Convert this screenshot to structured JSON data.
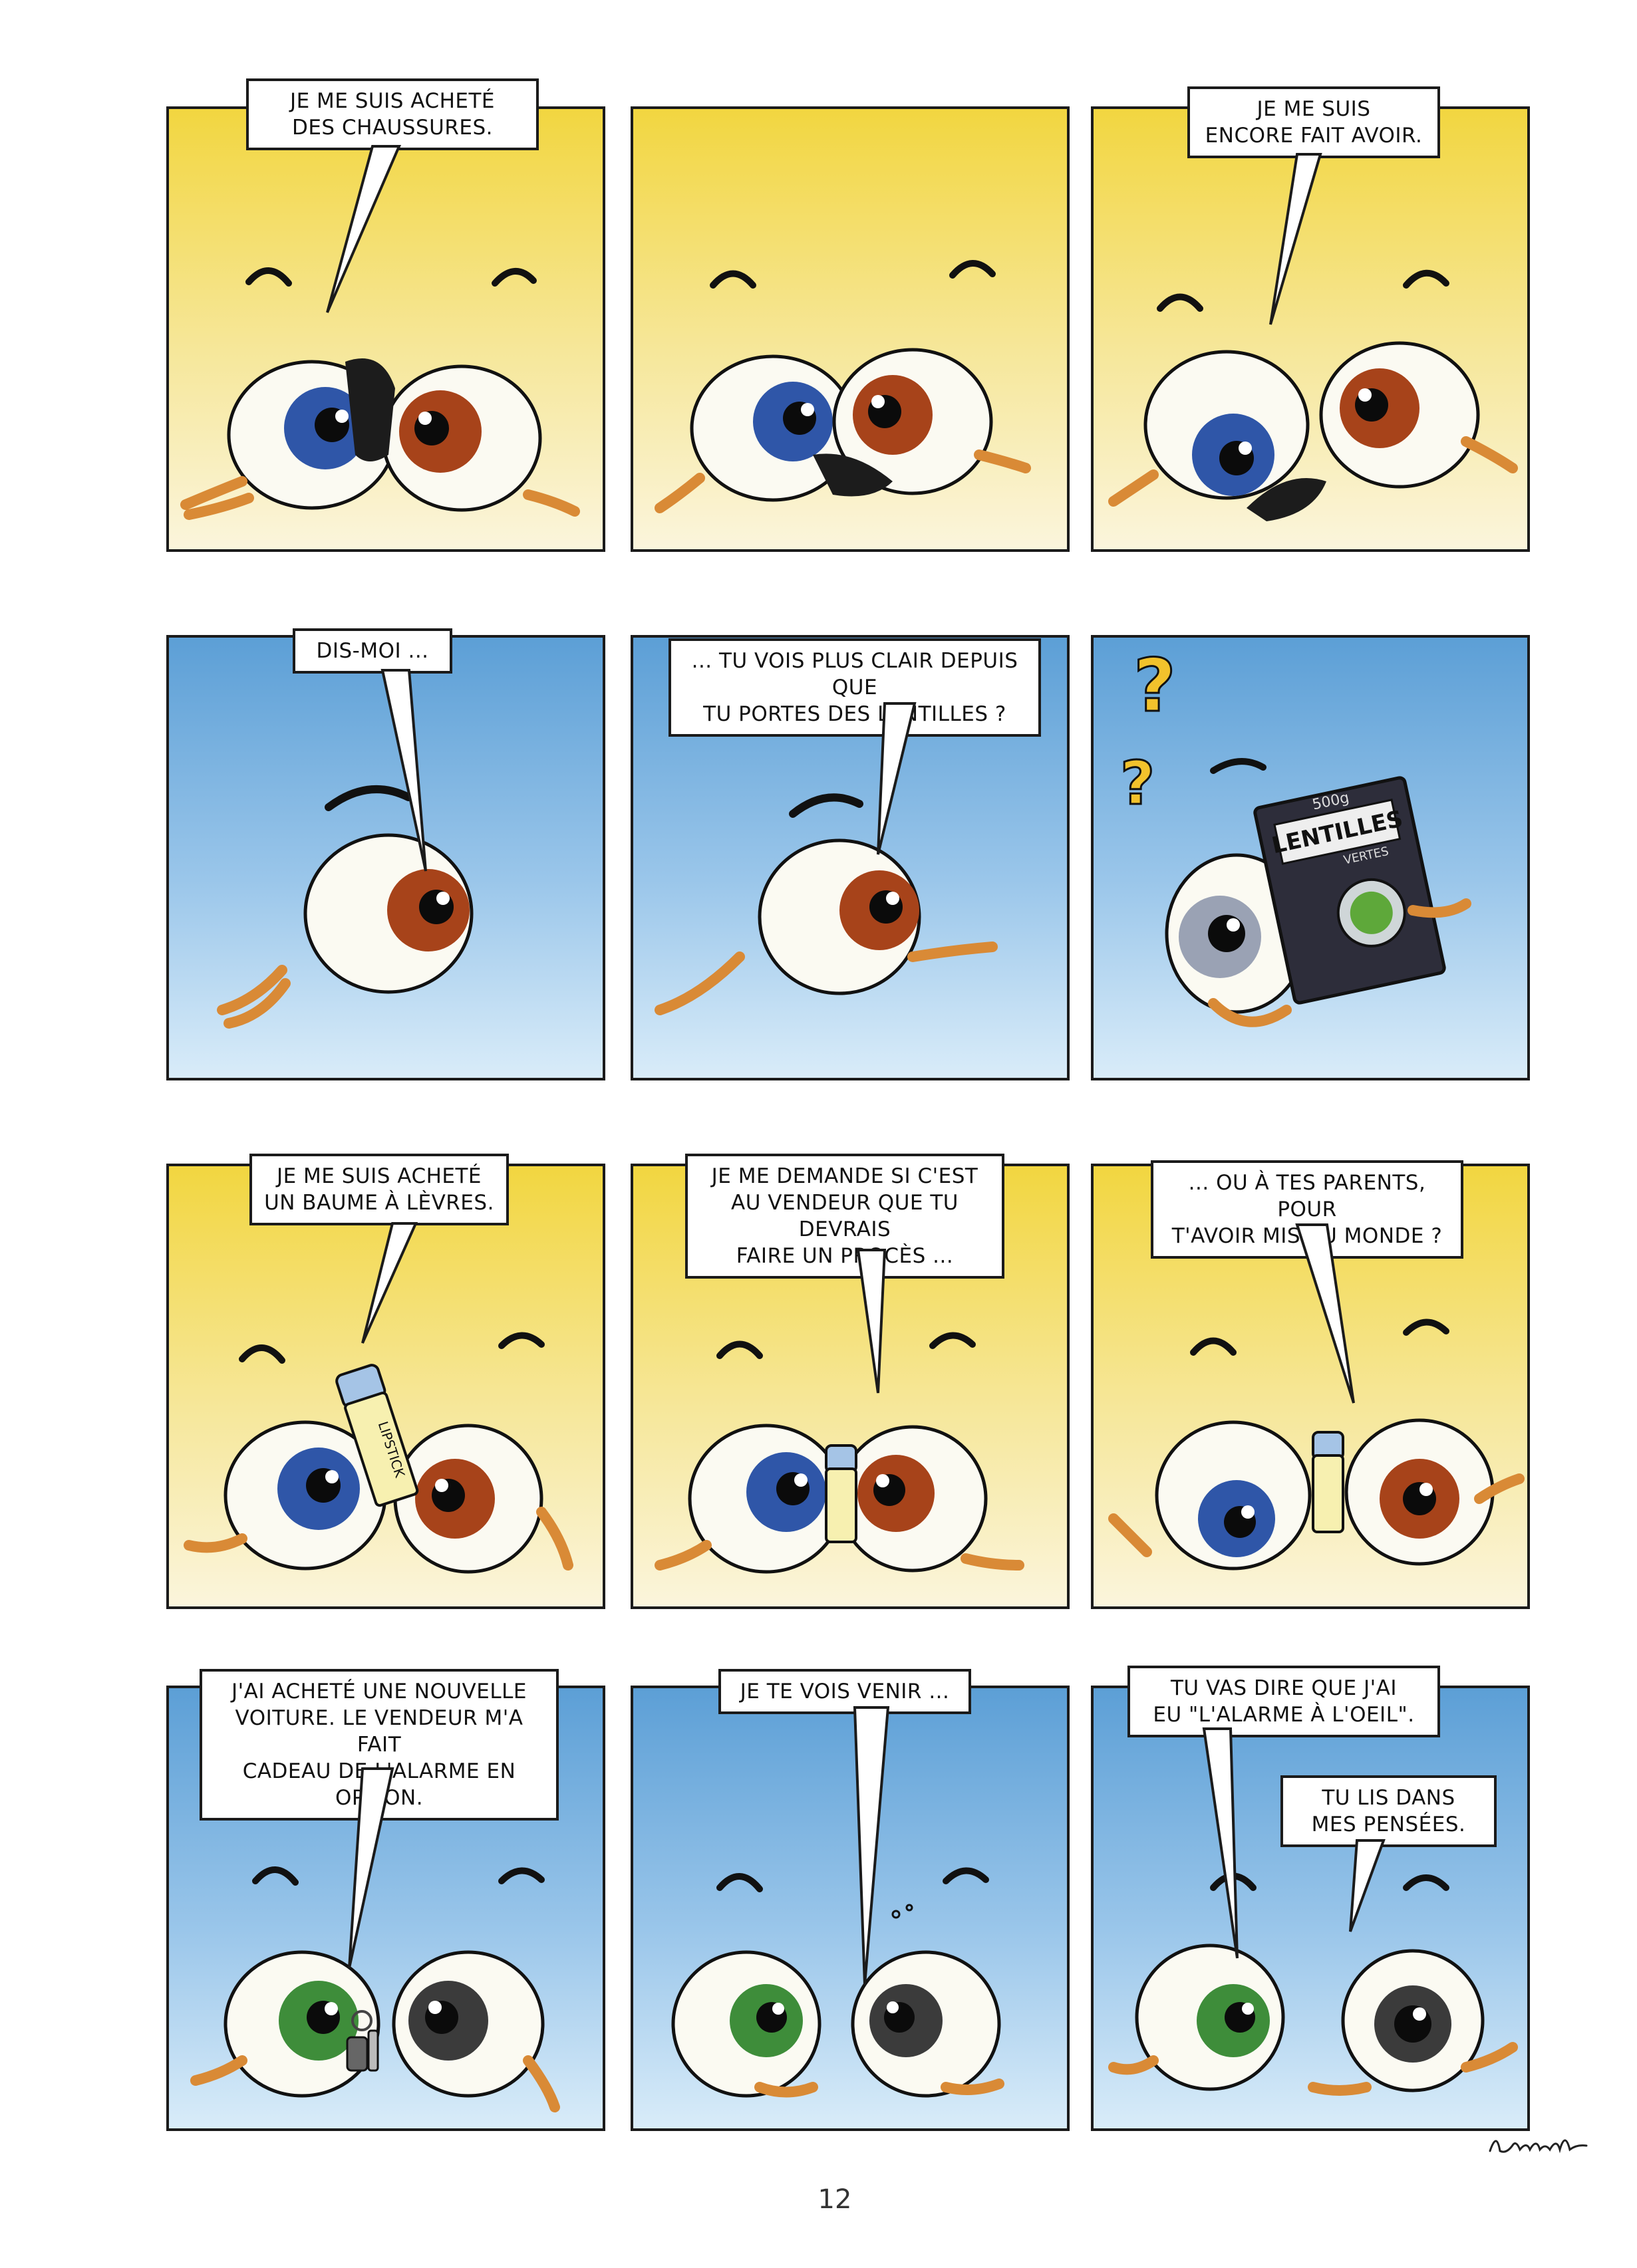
{
  "page_number": "12",
  "colors": {
    "yellow_panel": "#f2d640",
    "blue_panel": "#5c9fd6",
    "iris_blue": "#2f56a8",
    "iris_brown": "#a7431a",
    "iris_green": "#3e8d3a",
    "iris_gray": "#3b3b3b",
    "hands": "#f0a448"
  },
  "strips": [
    {
      "color": "yellow",
      "panels": [
        {
          "bubbles": [
            "JE ME SUIS ACHETÉ\nDES CHAUSSURES."
          ]
        },
        {
          "bubbles": []
        },
        {
          "bubbles": [
            "JE ME SUIS\nENCORE FAIT AVOIR."
          ]
        }
      ]
    },
    {
      "color": "blue",
      "panels": [
        {
          "bubbles": [
            "DIS-MOI ..."
          ]
        },
        {
          "bubbles": [
            "... TU VOIS PLUS CLAIR DEPUIS QUE\nTU PORTES DES LENTILLES ?"
          ]
        },
        {
          "bubbles": [],
          "box_text": {
            "weight": "500g",
            "name": "LENTILLES",
            "variant": "VERTES"
          },
          "marks": [
            "?",
            "?"
          ]
        }
      ]
    },
    {
      "color": "yellow",
      "panels": [
        {
          "bubbles": [
            "JE ME SUIS ACHETÉ\nUN BAUME À LÈVRES."
          ],
          "stick_label": "LIPSTICK"
        },
        {
          "bubbles": [
            "JE ME DEMANDE SI C'EST\nAU VENDEUR QUE TU DEVRAIS\nFAIRE UN PROCÈS ..."
          ]
        },
        {
          "bubbles": [
            "... OU À TES PARENTS, POUR\nT'AVOIR MIS AU MONDE ?"
          ]
        }
      ]
    },
    {
      "color": "blue",
      "panels": [
        {
          "bubbles": [
            "J'AI ACHETÉ UNE NOUVELLE\nVOITURE. LE VENDEUR M'A FAIT\nCADEAU DE L'ALARME EN OPTION."
          ]
        },
        {
          "bubbles": [
            "JE TE VOIS VENIR ..."
          ]
        },
        {
          "bubbles": [
            "TU VAS DIRE QUE J'AI\nEU \"L'ALARME À L'OEIL\".",
            "TU LIS DANS\nMES PENSÉES."
          ]
        }
      ]
    }
  ]
}
